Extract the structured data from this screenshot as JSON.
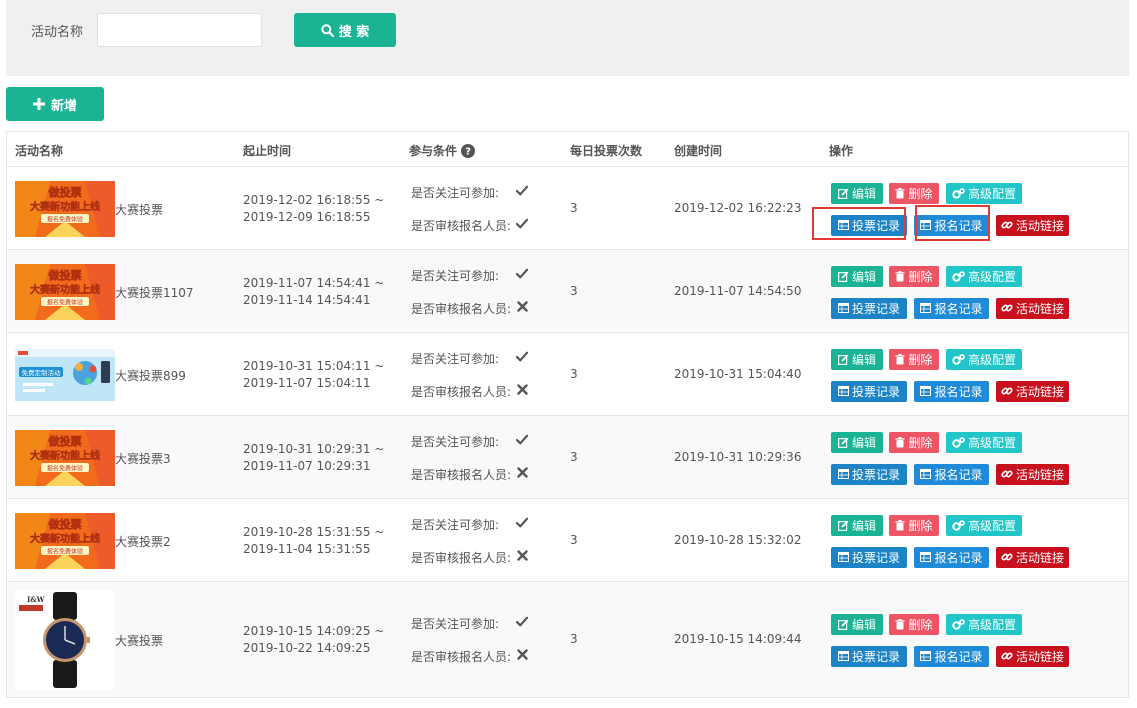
{
  "search": {
    "label": "活动名称",
    "input_value": "",
    "input_placeholder": "",
    "button_label": "搜 索"
  },
  "toolbar": {
    "add_label": "新增"
  },
  "table": {
    "headers": {
      "name": "活动名称",
      "period": "起止时间",
      "conditions": "参与条件",
      "daily_votes": "每日投票次数",
      "created": "创建时间",
      "actions": "操作"
    },
    "condition_labels": {
      "follow": "是否关注可参加:",
      "review": "是否审核报名人员:"
    },
    "action_labels": {
      "edit": "编辑",
      "delete": "删除",
      "advanced": "高级配置",
      "vote_records": "投票记录",
      "signup_records": "报名记录",
      "activity_link": "活动链接"
    },
    "rows": [
      {
        "name": "大赛投票",
        "image": "banner-orange",
        "start": "2019-12-02 16:18:55 ~",
        "end": "2019-12-09 16:18:55",
        "follow": "check",
        "review": "check",
        "daily_votes": "3",
        "created": "2019-12-02 16:22:23"
      },
      {
        "name": "大赛投票1107",
        "image": "banner-orange",
        "start": "2019-11-07 14:54:41 ~",
        "end": "2019-11-14 14:54:41",
        "follow": "check",
        "review": "cross",
        "daily_votes": "3",
        "created": "2019-11-07 14:54:50"
      },
      {
        "name": "大赛投票899",
        "image": "banner-blue",
        "start": "2019-10-31 15:04:11 ~",
        "end": "2019-11-07 15:04:11",
        "follow": "check",
        "review": "cross",
        "daily_votes": "3",
        "created": "2019-10-31 15:04:40"
      },
      {
        "name": "大赛投票3",
        "image": "banner-orange",
        "start": "2019-10-31 10:29:31 ~",
        "end": "2019-11-07 10:29:31",
        "follow": "check",
        "review": "cross",
        "daily_votes": "3",
        "created": "2019-10-31 10:29:36"
      },
      {
        "name": "大赛投票2",
        "image": "banner-orange",
        "start": "2019-10-28 15:31:55 ~",
        "end": "2019-11-04 15:31:55",
        "follow": "check",
        "review": "cross",
        "daily_votes": "3",
        "created": "2019-10-28 15:32:02"
      },
      {
        "name": "大赛投票",
        "image": "watch-photo",
        "start": "2019-10-15 14:09:25 ~",
        "end": "2019-10-22 14:09:25",
        "follow": "check",
        "review": "cross",
        "daily_votes": "3",
        "created": "2019-10-15 14:09:44"
      }
    ]
  },
  "banner_orange": {
    "line1": "做投票",
    "line2": "大赛新功能上线",
    "line3": "报名免费体验"
  },
  "banner_blue": {
    "line1": "免费定制活动"
  },
  "watch_brand": "I&W",
  "colors": {
    "primary": "#1ab394",
    "danger": "#ed5565",
    "info": "#23c6c8",
    "blue": "#1c84c6",
    "link": "#c9101d",
    "highlight": "#e53935"
  }
}
